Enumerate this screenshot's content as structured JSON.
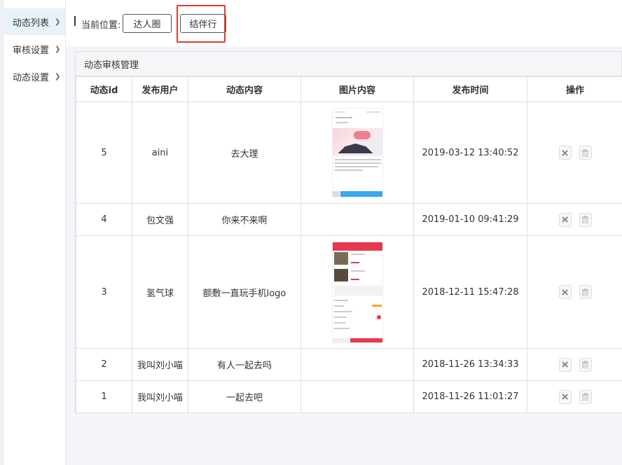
{
  "sidebar": {
    "items": [
      {
        "label": "动态列表",
        "active": true
      },
      {
        "label": "审核设置",
        "active": false
      },
      {
        "label": "动态设置",
        "active": false
      }
    ]
  },
  "breadcrumb": {
    "label": "当前位置:",
    "items": [
      "达人圈",
      "结伴行"
    ]
  },
  "panel": {
    "title": "动态审核管理",
    "columns": [
      "动态id",
      "发布用户",
      "动态内容",
      "图片内容",
      "发布时间",
      "操作"
    ],
    "rows": [
      {
        "id": "5",
        "user": "aini",
        "content": "去大理",
        "has_image": true,
        "time": "2019-03-12 13:40:52"
      },
      {
        "id": "4",
        "user": "包文强",
        "content": "你来不来啊",
        "has_image": false,
        "time": "2019-01-10 09:41:29"
      },
      {
        "id": "3",
        "user": "氢气球",
        "content": "额敷一直玩手机logo",
        "has_image": true,
        "time": "2018-12-11 15:47:28"
      },
      {
        "id": "2",
        "user": "我叫刘小喵",
        "content": "有人一起去吗",
        "has_image": false,
        "time": "2018-11-26 13:34:33"
      },
      {
        "id": "1",
        "user": "我叫刘小喵",
        "content": "一起去吧",
        "has_image": false,
        "time": "2018-11-26 11:01:27"
      }
    ]
  },
  "colors": {
    "highlight": "#e53935",
    "active_bg": "#e8f2fb",
    "thumb_red": "#e8384f",
    "thumb_blue": "#3aa8f0"
  },
  "icons": {
    "reject": "close-icon",
    "delete": "trash-icon",
    "chevron": "chevron-right-icon"
  }
}
